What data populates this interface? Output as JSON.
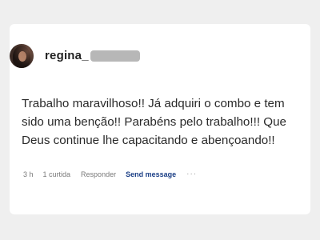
{
  "post": {
    "username": "regina_",
    "comment": "Trabalho maravilhoso!! Já adquiri o combo e tem sido uma benção!! Parabéns pelo trabalho!!! Que Deus continue lhe capacitando e abençoando!!",
    "time": "3 h",
    "likes": "1 curtida",
    "reply_label": "Responder",
    "send_label": "Send message",
    "more": "···"
  },
  "colors": {
    "background": "#efefef",
    "card": "#ffffff",
    "send_link": "#1b3f86",
    "redaction": "#b7b7b7"
  }
}
